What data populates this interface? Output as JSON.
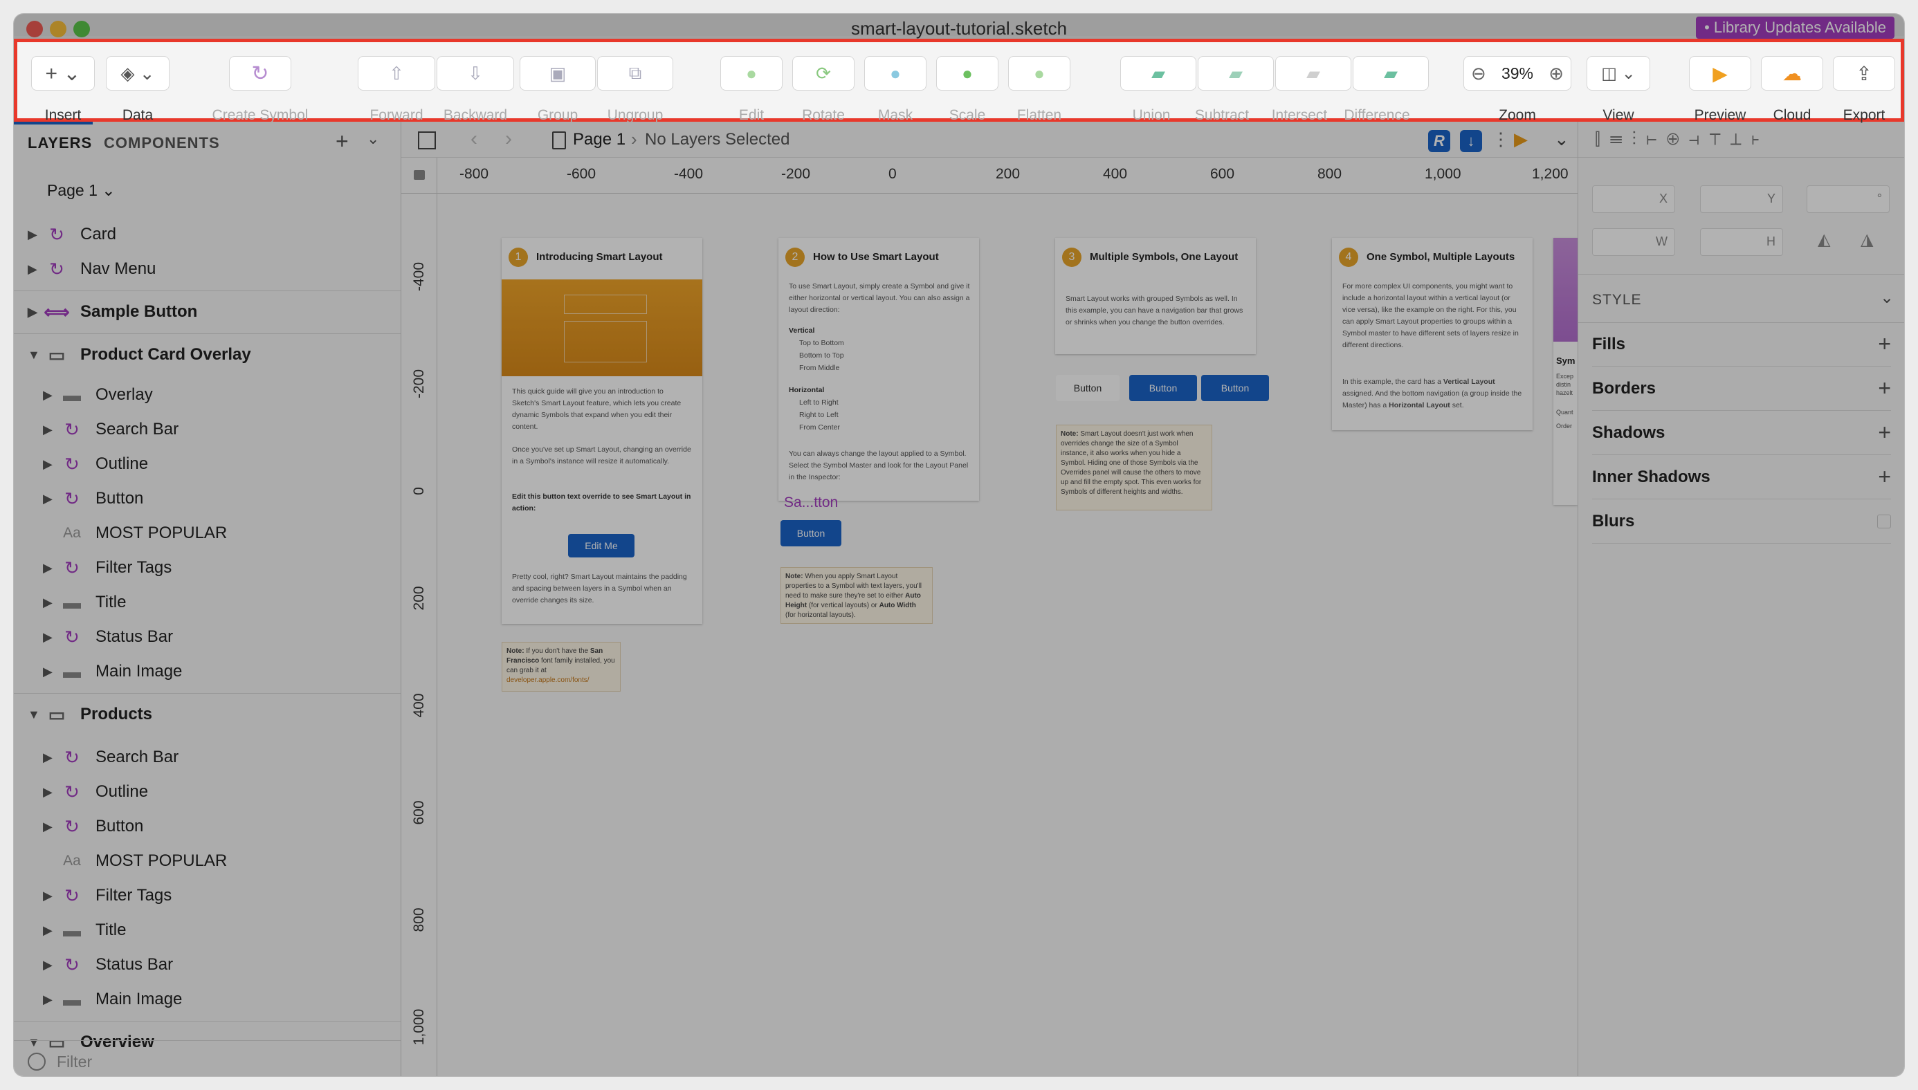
{
  "window": {
    "title": "smart-layout-tutorial.sketch",
    "library_badge": "• Library Updates Available"
  },
  "toolbar": {
    "insert": "Insert",
    "data": "Data",
    "create_symbol": "Create Symbol",
    "forward": "Forward",
    "backward": "Backward",
    "group": "Group",
    "ungroup": "Ungroup",
    "edit": "Edit",
    "rotate": "Rotate",
    "mask": "Mask",
    "scale": "Scale",
    "flatten": "Flatten",
    "union": "Union",
    "subtract": "Subtract",
    "intersect": "Intersect",
    "difference": "Difference",
    "zoom_value": "39%",
    "zoom": "Zoom",
    "view": "View",
    "preview": "Preview",
    "cloud": "Cloud",
    "export": "Export"
  },
  "sidebar": {
    "tab_layers": "LAYERS",
    "tab_components": "COMPONENTS",
    "page": "Page 1",
    "filter": "Filter",
    "layers": [
      {
        "name": "Card",
        "icon": "symbol-icon",
        "level": 0,
        "tri": true
      },
      {
        "name": "Nav Menu",
        "icon": "symbol-icon",
        "level": 0,
        "tri": true
      },
      {
        "name": "Sample Button",
        "icon": "symbol-master-icon",
        "level": 0,
        "tri": true,
        "bold": true
      },
      {
        "name": "Product Card Overlay",
        "icon": "artboard-icon",
        "level": 0,
        "tri": true,
        "bold": true,
        "open": true
      },
      {
        "name": "Overlay",
        "icon": "folder-icon",
        "level": 1,
        "tri": true
      },
      {
        "name": "Search Bar",
        "icon": "symbol-icon",
        "level": 1,
        "tri": true
      },
      {
        "name": "Outline",
        "icon": "symbol-icon",
        "level": 1,
        "tri": true
      },
      {
        "name": "Button",
        "icon": "symbol-icon",
        "level": 1,
        "tri": true
      },
      {
        "name": "MOST POPULAR",
        "icon": "text-icon",
        "level": 1,
        "tri": false
      },
      {
        "name": "Filter Tags",
        "icon": "symbol-icon",
        "level": 1,
        "tri": true
      },
      {
        "name": "Title",
        "icon": "folder-icon",
        "level": 1,
        "tri": true
      },
      {
        "name": "Status Bar",
        "icon": "symbol-alt-icon",
        "level": 1,
        "tri": true
      },
      {
        "name": "Main Image",
        "icon": "folder-icon",
        "level": 1,
        "tri": true
      },
      {
        "name": "Products",
        "icon": "artboard-icon",
        "level": 0,
        "tri": true,
        "bold": true,
        "open": true
      },
      {
        "name": "Search Bar",
        "icon": "symbol-icon",
        "level": 1,
        "tri": true
      },
      {
        "name": "Outline",
        "icon": "symbol-icon",
        "level": 1,
        "tri": true
      },
      {
        "name": "Button",
        "icon": "symbol-icon",
        "level": 1,
        "tri": true
      },
      {
        "name": "MOST POPULAR",
        "icon": "text-icon",
        "level": 1,
        "tri": false
      },
      {
        "name": "Filter Tags",
        "icon": "symbol-icon",
        "level": 1,
        "tri": true
      },
      {
        "name": "Title",
        "icon": "folder-icon",
        "level": 1,
        "tri": true
      },
      {
        "name": "Status Bar",
        "icon": "symbol-alt-icon",
        "level": 1,
        "tri": true
      },
      {
        "name": "Main Image",
        "icon": "folder-icon",
        "level": 1,
        "tri": true
      },
      {
        "name": "Overview",
        "icon": "artboard-icon",
        "level": 0,
        "tri": true,
        "bold": true,
        "open": true
      }
    ]
  },
  "canvas": {
    "breadcrumb_page": "Page 1",
    "breadcrumb_sel": "No Layers Selected",
    "hticks": [
      "-800",
      "-600",
      "-400",
      "-200",
      "0",
      "200",
      "400",
      "600",
      "800",
      "1,000",
      "1,200"
    ],
    "vticks": [
      "-400",
      "-200",
      "0",
      "200",
      "400",
      "600",
      "800",
      "1,000"
    ],
    "card1": {
      "num": "1",
      "title": "Introducing Smart Layout",
      "p1": "This quick guide will give you an introduction to Sketch's Smart Layout feature, which lets you create dynamic Symbols that expand when you edit their content.",
      "p2": "Once you've set up Smart Layout, changing an override in a Symbol's instance will resize it automatically.",
      "p3": "Edit this button text override to see Smart Layout in action:",
      "btn": "Edit Me",
      "p4": "Pretty cool, right? Smart Layout maintains the padding and spacing between layers in a Symbol when an override changes its size."
    },
    "note1": {
      "b": "Note:",
      "t": " If you don't have the ",
      "b2": "San Francisco",
      "t2": " font family installed, you can grab it at ",
      "link": "developer.apple.com/fonts/"
    },
    "card2": {
      "num": "2",
      "title": "How to Use Smart Layout",
      "p1": "To use Smart Layout, simply create a Symbol and give it either horizontal or vertical layout. You can also assign a layout direction:",
      "vh": "Vertical",
      "v1": "Top to Bottom",
      "v2": "Bottom to Top",
      "v3": "From Middle",
      "hh": "Horizontal",
      "h1": "Left to Right",
      "h2": "Right to Left",
      "h3": "From Center",
      "p2": "You can always change the layout applied to a Symbol. Select the Symbol Master and look for the Layout Panel in the Inspector:"
    },
    "sel_label": "Sa...tton",
    "btn2": "Button",
    "note2": {
      "b": "Note:",
      "t": " When you apply Smart Layout properties to a Symbol with text layers, you'll need to make sure they're set to either ",
      "b2": "Auto Height",
      "t2": " (for vertical layouts) or ",
      "b3": "Auto Width",
      "t3": " (for horizontal layouts)."
    },
    "card3": {
      "num": "3",
      "title": "Multiple Symbols, One Layout",
      "p1": "Smart Layout works with grouped Symbols as well. In this example, you can have a navigation bar that grows or shrinks when you change the button overrides."
    },
    "btn3a": "Button",
    "btn3b": "Button",
    "btn3c": "Button",
    "note3": {
      "b": "Note:",
      "t": " Smart Layout doesn't just work when overrides change the size of a Symbol instance, it also works when you hide a Symbol. Hiding one of those Symbols via the Overrides panel will cause the others to move up and fill the empty spot. This even works for Symbols of different heights and widths."
    },
    "card4": {
      "num": "4",
      "title": "One Symbol, Multiple Layouts",
      "p1": "For more complex UI components, you might want to include a horizontal layout within a vertical layout (or vice versa), like the example on the right. For this, you can apply Smart Layout properties to groups within a Symbol master to have different sets of layers resize in different directions.",
      "p2a": "In this example, the card has a ",
      "p2b": "Vertical Layout",
      "p2c": " assigned. And the bottom navigation (a group inside the Master) has a ",
      "p2d": "Horizontal Layout",
      "p2e": " set."
    },
    "card5": {
      "title": "Sym",
      "t1": "Excep",
      "t2": "distin",
      "t3": "hazelt",
      "q": "Quant",
      "o": "Order"
    }
  },
  "inspector": {
    "x": "X",
    "y": "Y",
    "deg": "°",
    "w": "W",
    "h": "H",
    "style": "STYLE",
    "fills": "Fills",
    "borders": "Borders",
    "shadows": "Shadows",
    "inner_shadows": "Inner Shadows",
    "blurs": "Blurs"
  },
  "colors": {
    "accent": "#1a63c7",
    "highlight": "#e8382b",
    "symbol": "#a33dbf"
  }
}
